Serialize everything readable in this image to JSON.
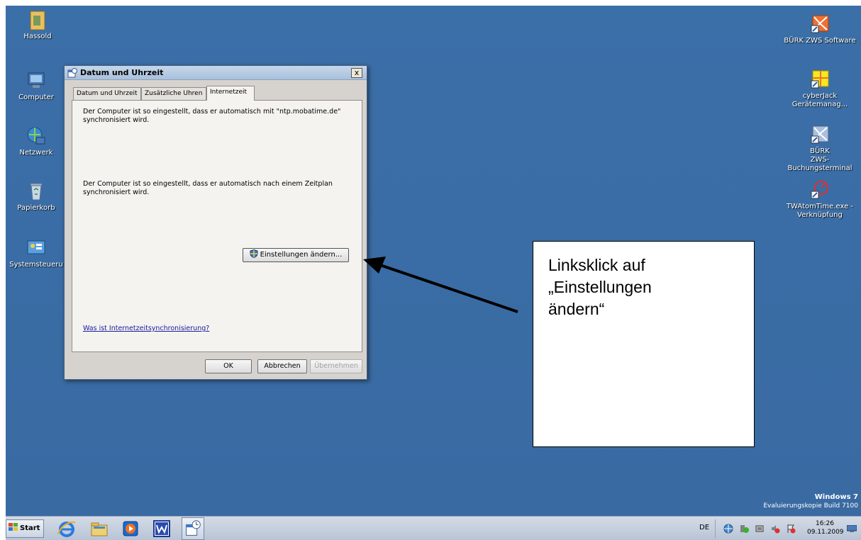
{
  "desktop": {
    "left_icons": [
      {
        "label": "Hassold",
        "icon": "folder-user-icon"
      },
      {
        "label": "Computer",
        "icon": "computer-icon"
      },
      {
        "label": "Netzwerk",
        "icon": "network-icon"
      },
      {
        "label": "Papierkorb",
        "icon": "recycle-bin-icon"
      },
      {
        "label": "Systemsteueru",
        "icon": "control-panel-icon"
      }
    ],
    "right_icons": [
      {
        "label": "BÜRK ZWS Software",
        "icon": "buerk-zws-icon"
      },
      {
        "label": "cyberJack Gerätemanag...",
        "icon": "cyberjack-icon"
      },
      {
        "label": "BÜRK ZWS-Buchungsterminal",
        "label_line1": "BÜRK",
        "label_line2": "ZWS-Buchungsterminal",
        "icon": "buerk-terminal-icon"
      },
      {
        "label": "TWAtomTime.exe - Verknüpfung",
        "label_line1": "TWAtomTime.exe -",
        "label_line2": "Verknüpfung",
        "icon": "atomtime-icon"
      }
    ],
    "watermark": {
      "line1": "Windows 7",
      "line2": "Evaluierungskopie Build 7100"
    }
  },
  "dialog": {
    "title": "Datum und Uhrzeit",
    "close_label": "x",
    "tabs": [
      {
        "label": "Datum und Uhrzeit",
        "active": false
      },
      {
        "label": "Zusätzliche Uhren",
        "active": false
      },
      {
        "label": "Internetzeit",
        "active": true
      }
    ],
    "text1": "Der Computer ist so eingestellt, dass er automatisch mit \"ntp.mobatime.de\" synchronisiert wird.",
    "text2": "Der Computer ist so eingestellt, dass er automatisch nach einem Zeitplan synchronisiert wird.",
    "change_button": "Einstellungen ändern...",
    "help_link": "Was ist Internetzeitsynchronisierung?",
    "ok_button": "OK",
    "cancel_button": "Abbrechen",
    "apply_button": "Übernehmen"
  },
  "callout": {
    "line1": "Linksklick auf",
    "line2": "„Einstellungen",
    "line3": "ändern“"
  },
  "taskbar": {
    "start_label": "Start",
    "pinned": [
      "internet-explorer-icon",
      "explorer-icon",
      "media-player-icon",
      "word-icon",
      "date-time-icon"
    ],
    "language": "DE",
    "tray_icons": [
      "network-tray-icon",
      "security-tray-icon",
      "battery-tray-icon",
      "volume-tray-icon",
      "action-center-icon"
    ],
    "time": "16:26",
    "date": "09.11.2009"
  },
  "colors": {
    "desktop": "#3a6ea5",
    "dialog": "#d6d3ce",
    "link": "#1a1aa0"
  }
}
